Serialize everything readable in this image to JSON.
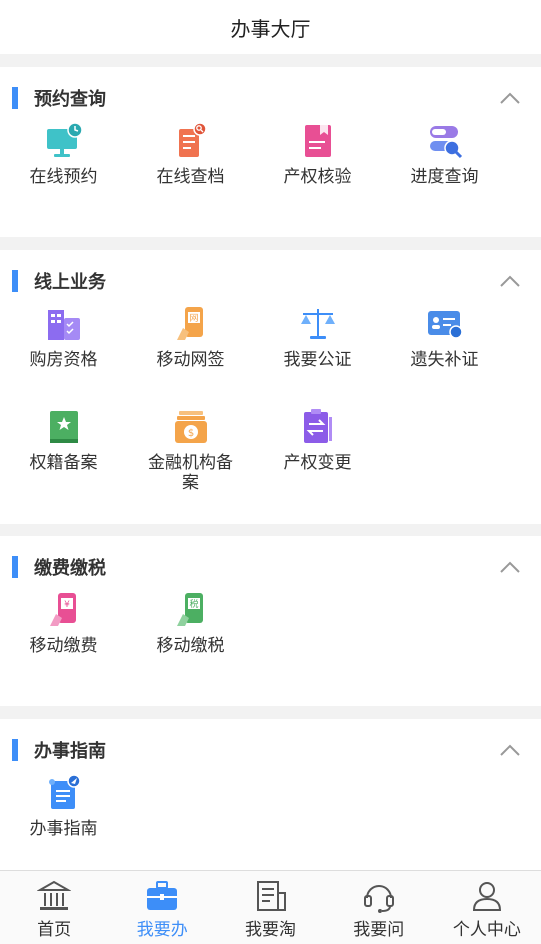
{
  "header": {
    "title": "办事大厅"
  },
  "sections": [
    {
      "title": "预约查询",
      "items": [
        {
          "label": "在线预约",
          "icon": "monitor-clock-icon"
        },
        {
          "label": "在线查档",
          "icon": "document-search-icon"
        },
        {
          "label": "产权核验",
          "icon": "bookmark-doc-icon"
        },
        {
          "label": "进度查询",
          "icon": "progress-search-icon"
        }
      ]
    },
    {
      "title": "线上业务",
      "items": [
        {
          "label": "购房资格",
          "icon": "building-checklist-icon"
        },
        {
          "label": "移动网签",
          "icon": "mobile-sign-icon"
        },
        {
          "label": "我要公证",
          "icon": "scales-icon"
        },
        {
          "label": "遗失补证",
          "icon": "id-card-icon"
        },
        {
          "label": "权籍备案",
          "icon": "star-book-icon"
        },
        {
          "label": "金融机构备案",
          "icon": "coin-box-icon"
        },
        {
          "label": "产权变更",
          "icon": "transfer-doc-icon"
        }
      ]
    },
    {
      "title": "缴费缴税",
      "items": [
        {
          "label": "移动缴费",
          "icon": "mobile-pay-icon"
        },
        {
          "label": "移动缴税",
          "icon": "mobile-tax-icon"
        }
      ]
    },
    {
      "title": "办事指南",
      "items": [
        {
          "label": "办事指南",
          "icon": "guide-scroll-icon"
        }
      ]
    }
  ],
  "nav": [
    {
      "label": "首页",
      "icon": "bank-icon",
      "active": false
    },
    {
      "label": "我要办",
      "icon": "briefcase-icon",
      "active": true
    },
    {
      "label": "我要淘",
      "icon": "news-icon",
      "active": false
    },
    {
      "label": "我要问",
      "icon": "headset-icon",
      "active": false
    },
    {
      "label": "个人中心",
      "icon": "user-icon",
      "active": false
    }
  ],
  "colors": {
    "accent": "#3d8ef8",
    "text": "#333333",
    "background": "#f2f2f2"
  }
}
